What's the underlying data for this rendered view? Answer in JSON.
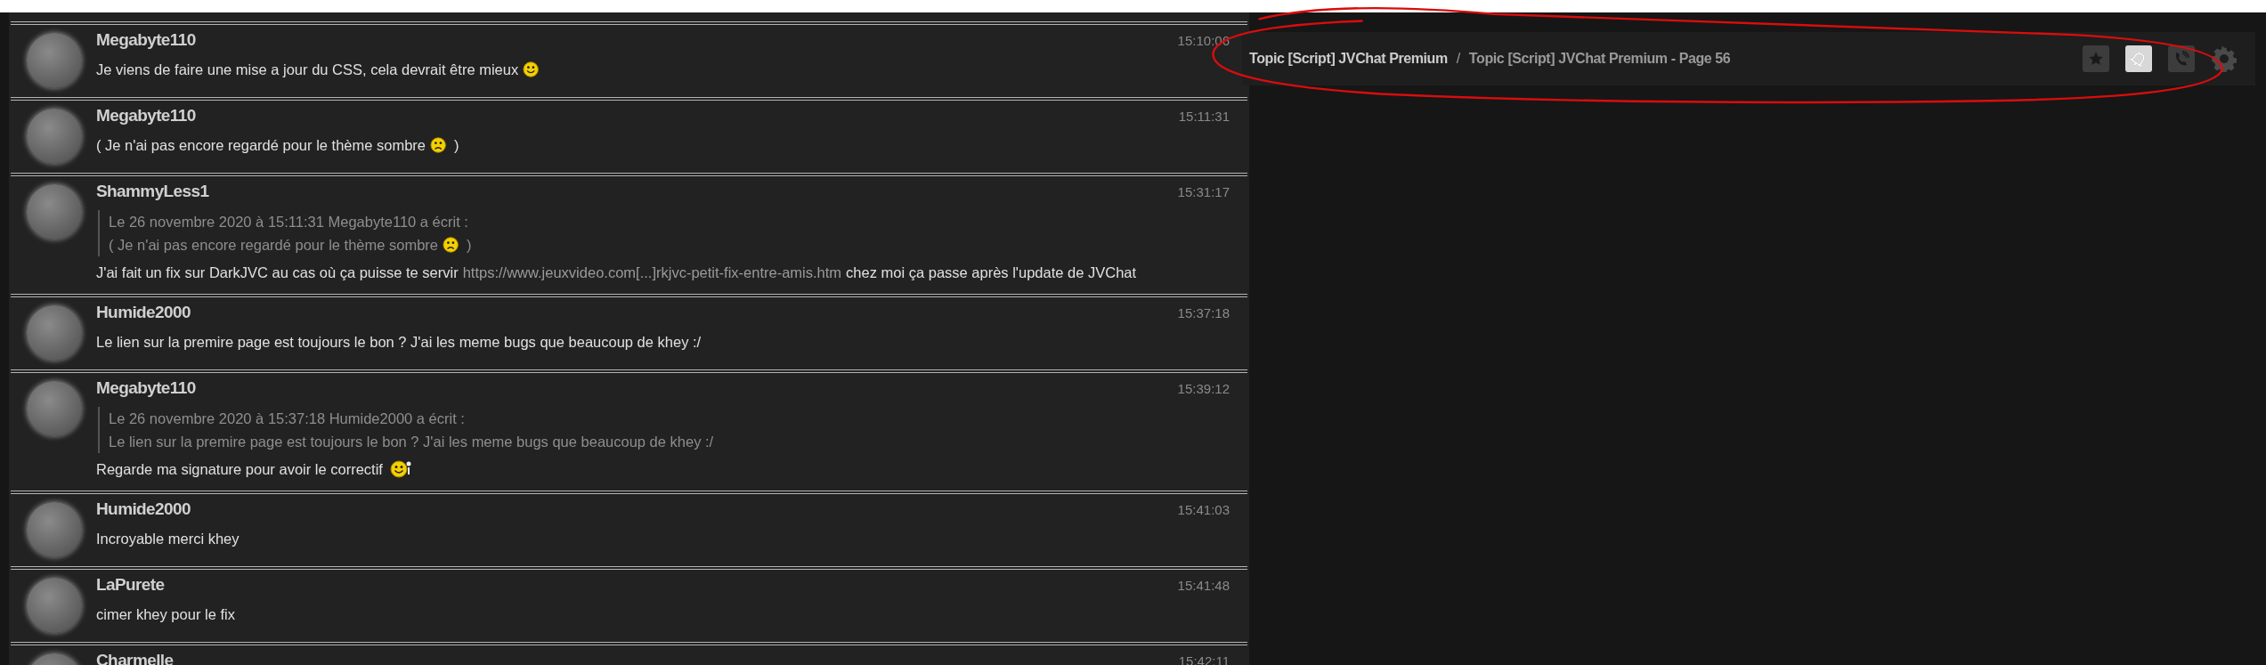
{
  "header": {
    "breadcrumb_parent": "Topic [Script] JVChat Premium",
    "separator": "/",
    "breadcrumb_current": "Topic [Script] JVChat Premium - Page 56",
    "buttons": [
      {
        "kind": "star",
        "on": false
      },
      {
        "kind": "bell",
        "on": true
      },
      {
        "kind": "phone",
        "on": false
      },
      {
        "kind": "gear",
        "on": false
      }
    ]
  },
  "messages": [
    {
      "author": "Megabyte110",
      "time": "15:10:06",
      "body": [
        {
          "kind": "text",
          "text": "Je viens de faire une mise a jour du CSS, cela devrait être mieux"
        },
        {
          "kind": "smile"
        }
      ]
    },
    {
      "author": "Megabyte110",
      "time": "15:11:31",
      "body": [
        {
          "kind": "text",
          "text": "( Je n'ai pas encore regardé pour le thème sombre"
        },
        {
          "kind": "frown"
        },
        {
          "kind": "text",
          "text": ")"
        }
      ]
    },
    {
      "author": "ShammyLess1",
      "time": "15:31:17",
      "quote": {
        "header": "Le 26 novembre 2020 à 15:11:31 Megabyte110 a écrit :",
        "body": [
          {
            "kind": "text",
            "text": "( Je n'ai pas encore regardé pour le thème sombre"
          },
          {
            "kind": "frown"
          },
          {
            "kind": "text",
            "text": ")"
          }
        ]
      },
      "body": [
        {
          "kind": "text",
          "text": "J'ai fait un fix sur DarkJVC au cas où ça puisse te servir"
        },
        {
          "kind": "link",
          "text": "https://www.jeuxvideo.com[...]rkjvc-petit-fix-entre-amis.htm"
        },
        {
          "kind": "text",
          "text": "chez moi ça passe après l'update de JVChat"
        }
      ]
    },
    {
      "author": "Humide2000",
      "time": "15:37:18",
      "body": [
        {
          "kind": "text",
          "text": "Le lien sur la premire page est toujours le bon ? J'ai les meme bugs que beaucoup de khey :/"
        }
      ]
    },
    {
      "author": "Megabyte110",
      "time": "15:39:12",
      "quote": {
        "header": "Le 26 novembre 2020 à 15:37:18 Humide2000 a écrit :",
        "body": [
          {
            "kind": "text",
            "text": "Le lien sur la premire page est toujours le bon ? J'ai les meme bugs que beaucoup de khey :/"
          }
        ]
      },
      "body": [
        {
          "kind": "text",
          "text": "Regarde ma signature pour avoir le correctif"
        },
        {
          "kind": "wink"
        }
      ]
    },
    {
      "author": "Humide2000",
      "time": "15:41:03",
      "body": [
        {
          "kind": "text",
          "text": "Incroyable merci khey"
        }
      ]
    },
    {
      "author": "LaPurete",
      "time": "15:41:48",
      "body": [
        {
          "kind": "text",
          "text": "cimer khey pour le fix"
        }
      ]
    },
    {
      "author": "Charmelle",
      "time": "15:42:11"
    }
  ]
}
